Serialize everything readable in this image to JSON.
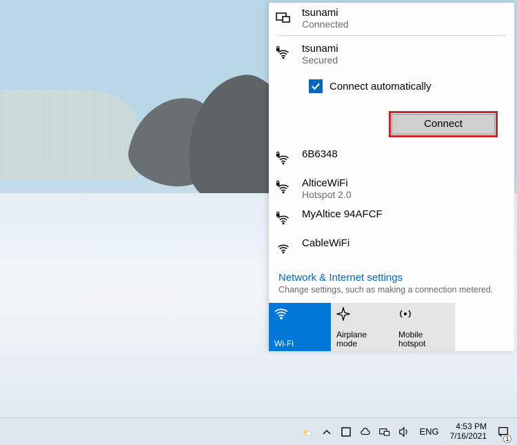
{
  "ethernet": {
    "name": "tsunami",
    "status": "Connected"
  },
  "selected": {
    "name": "tsunami",
    "status": "Secured",
    "auto_label": "Connect automatically",
    "auto_checked": true,
    "connect_label": "Connect"
  },
  "networks": [
    {
      "name": "6B6348",
      "sub": "",
      "secured": true
    },
    {
      "name": "AlticeWiFi",
      "sub": "Hotspot 2.0",
      "secured": true
    },
    {
      "name": "MyAltice 94AFCF",
      "sub": "",
      "secured": true
    },
    {
      "name": "CableWiFi",
      "sub": "",
      "secured": false
    }
  ],
  "settings": {
    "title": "Network & Internet settings",
    "sub": "Change settings, such as making a connection metered."
  },
  "tiles": {
    "wifi": "Wi-Fi",
    "airplane": "Airplane mode",
    "hotspot": "Mobile hotspot"
  },
  "tray": {
    "lang": "ENG",
    "time": "4:53 PM",
    "date": "7/16/2021",
    "notif_count": "1"
  }
}
